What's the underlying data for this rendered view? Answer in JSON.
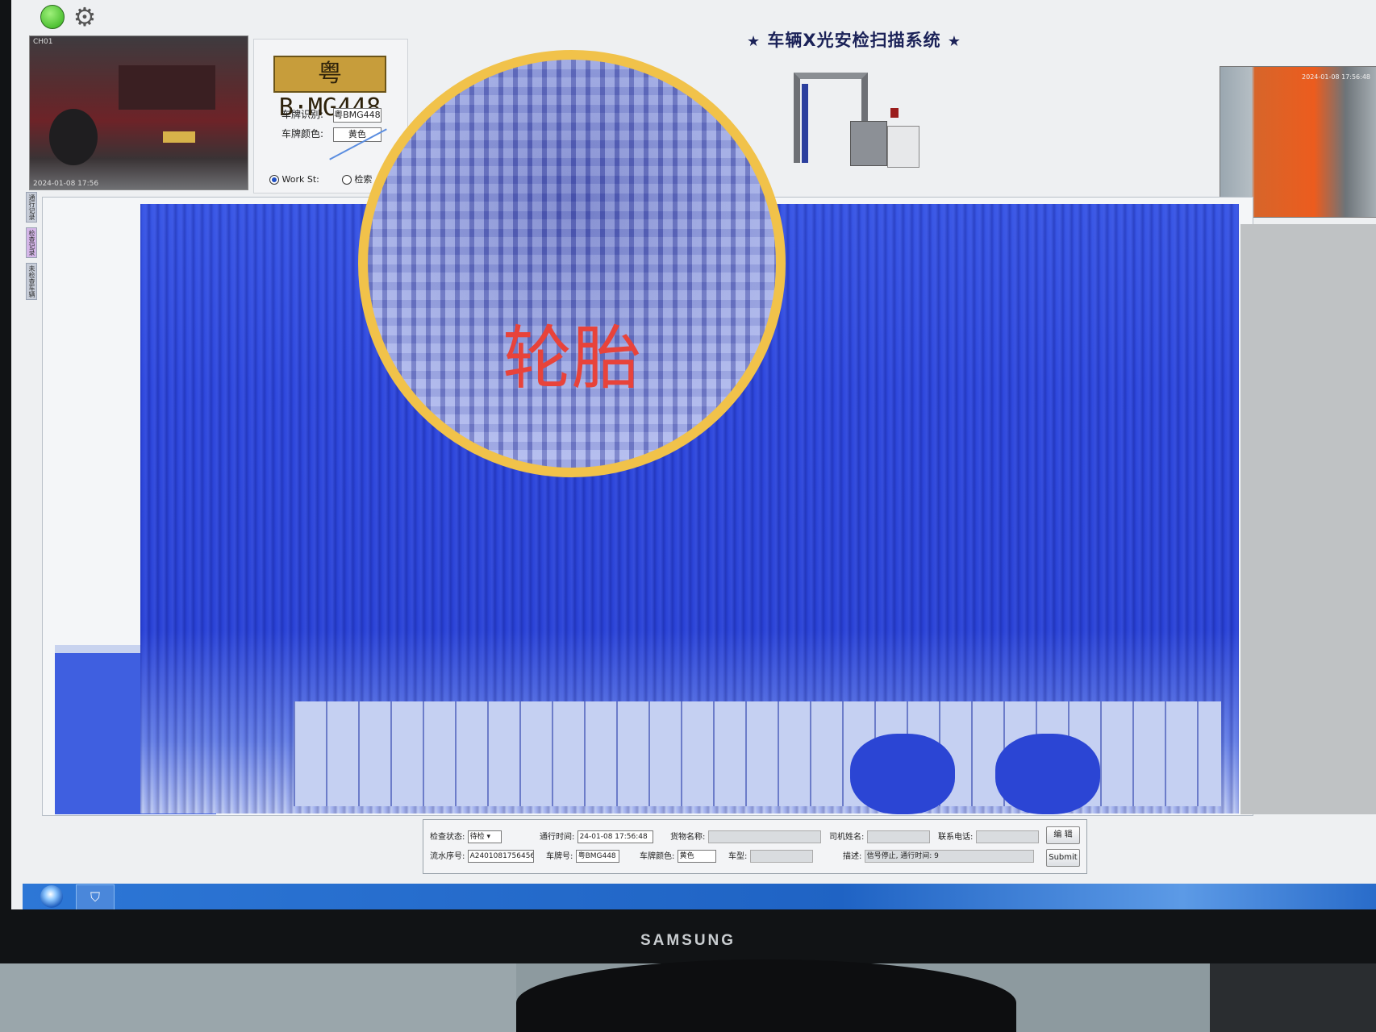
{
  "app": {
    "title": "车辆X光安检扫描系统",
    "title_wing_left": "★",
    "title_wing_right": "★"
  },
  "cameras": {
    "front_stamp_top": "CH01",
    "front_stamp_bottom": "2024-01-08 17:56",
    "rear_stamp": "2024-01-08 17:56:48"
  },
  "plate": {
    "image_text": "粤B·MG448",
    "recognized_label": "车牌识别:",
    "recognized_value": "粤BMG448",
    "color_label": "车牌颜色:",
    "color_value": "黄色"
  },
  "mode_radios": [
    {
      "label": "Work St:",
      "selected": true
    },
    {
      "label": "检索",
      "selected": false
    }
  ],
  "side_tabs": [
    "通行记录",
    "检查记录",
    "未检查车辆"
  ],
  "magnifier": {
    "label": "轮胎",
    "border_color": "#f1c24a",
    "label_color": "#e8433a"
  },
  "form": {
    "status_label": "检查状态:",
    "status_value": "待检",
    "time_label": "通行时间:",
    "time_value": "24-01-08 17:56:48",
    "goods_label": "货物名称:",
    "goods_value": "",
    "driver_label": "司机姓名:",
    "driver_value": "",
    "phone_label": "联系电话:",
    "phone_value": "",
    "serial_label": "流水序号:",
    "serial_value": "A2401081756456",
    "plate_label": "车牌号:",
    "plate_value": "粤BMG448",
    "plate_color_label": "车牌颜色:",
    "plate_color_value": "黄色",
    "vehicle_type_label": "车型:",
    "vehicle_type_value": "",
    "desc_label": "描述:",
    "desc_value": "信号停止, 通行时间: 9",
    "edit_button": "编 辑",
    "submit_button": "Submit"
  },
  "monitor": {
    "brand": "SAMSUNG"
  },
  "colors": {
    "xray_blue": "#2f49de",
    "taskbar": "#1f63c4"
  },
  "icons": [
    "status-led-icon",
    "gear-icon",
    "start-orb-icon",
    "app-shield-icon"
  ]
}
